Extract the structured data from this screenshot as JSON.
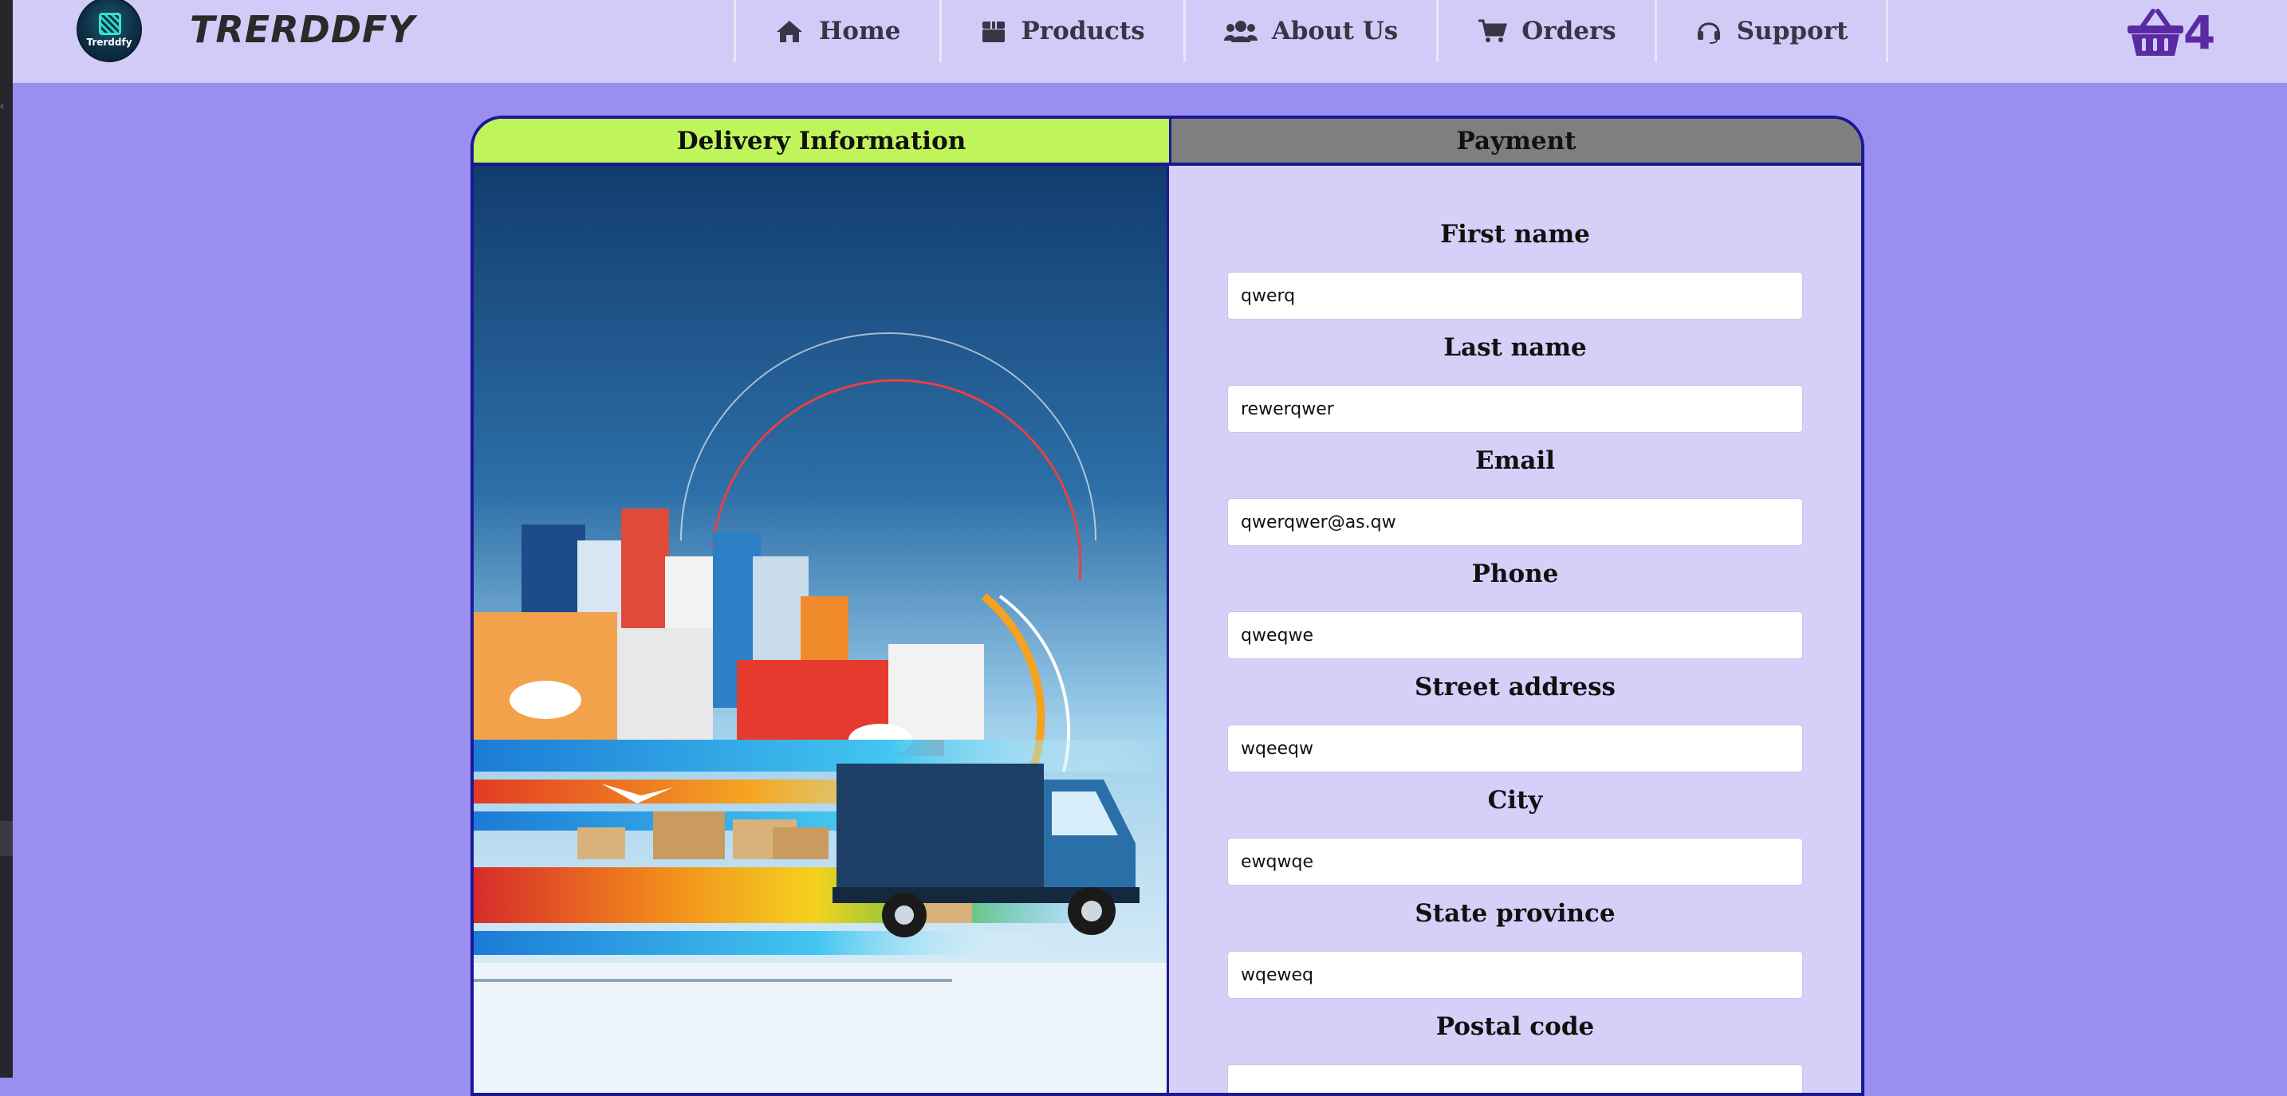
{
  "brand": {
    "logo_text": "Trerddfy",
    "name": "TRERDDFY"
  },
  "nav": {
    "items": [
      {
        "label": "Home",
        "icon": "home-icon"
      },
      {
        "label": "Products",
        "icon": "box-icon"
      },
      {
        "label": "About Us",
        "icon": "users-icon"
      },
      {
        "label": "Orders",
        "icon": "cart-icon"
      },
      {
        "label": "Support",
        "icon": "headset-icon"
      }
    ]
  },
  "cart": {
    "icon": "basket-icon",
    "count": "4"
  },
  "tabs": {
    "delivery": "Delivery Information",
    "payment": "Payment"
  },
  "form": {
    "first_name": {
      "label": "First name",
      "value": "qwerq"
    },
    "last_name": {
      "label": "Last name",
      "value": "rewerqwer"
    },
    "email": {
      "label": "Email",
      "value": "qwerqwer@as.qw"
    },
    "phone": {
      "label": "Phone",
      "value": "qweqwe"
    },
    "street": {
      "label": "Street address",
      "value": "wqeeqw"
    },
    "city": {
      "label": "City",
      "value": "ewqwqe"
    },
    "state": {
      "label": "State province",
      "value": "wqeweq"
    },
    "postal": {
      "label": "Postal code",
      "value": ""
    }
  },
  "colors": {
    "page_bg": "#9a8ef1",
    "navbar_bg": "#d1cbf8",
    "active_tab": "#bff55b",
    "inactive_tab": "#7f7f7f",
    "card_border": "#1a1894",
    "cart_accent": "#5b2aa3"
  }
}
